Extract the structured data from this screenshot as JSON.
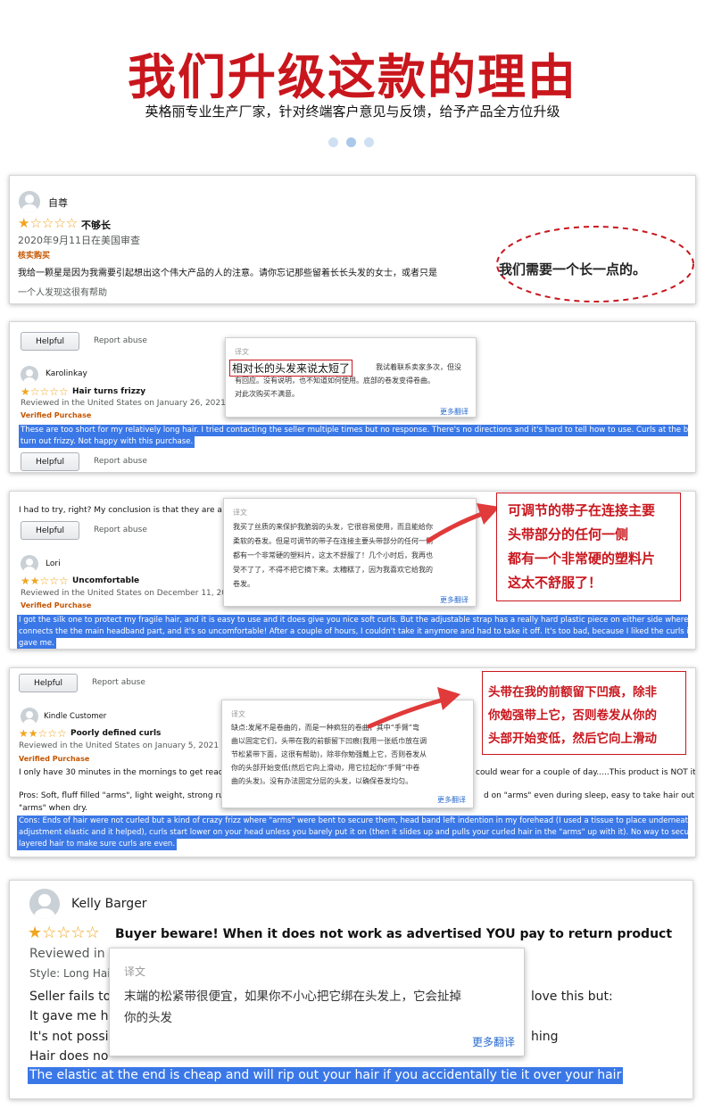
{
  "hero": {
    "title": "我们升级这款的理由",
    "subtitle": "英格丽专业生产厂家，针对终端客户意见与反馈，给予产品全方位升级"
  },
  "review1": {
    "author": "自尊",
    "stars": "★☆☆☆☆",
    "headline": "不够长",
    "date": "2020年9月11日在美国审查",
    "verified": "核实购买",
    "body": "我给一颗星是因为我需要引起想出这个伟大产品的人的注意。请你忘记那些留着长长头发的女士，或者只是",
    "callout": "我们需要一个长一点的。",
    "helpful": "一个人发现这很有帮助"
  },
  "review2": {
    "helpful_btn": "Helpful",
    "report": "Report abuse",
    "author": "Karolinkay",
    "stars": "★☆☆☆☆",
    "headline": "Hair turns frizzy",
    "date": "Reviewed in the United States on January 26, 2021",
    "verified": "Verified Purchase",
    "body1": "These are too short for my relatively long hair. I tried contacting the seller multiple times but no response. There's no directions and it's hard to tell how to use. Curls at the bottom",
    "body2": "turn out frizzy. Not happy with this purchase.",
    "helpful_btn2": "Helpful",
    "report2": "Report abuse",
    "popup": {
      "label": "译文",
      "boxed": "相对长的头发来说太短了",
      "line1_tail": "我试着联系卖家多次，但没",
      "line2": "有回应。没有说明，也不知道如何使用。底部的卷发变得卷曲。",
      "line3": "对此次购买不满意。",
      "more": "更多翻译"
    }
  },
  "review3": {
    "top_text": "I had to try, right? My conclusion is that they are a was",
    "helpful_btn": "Helpful",
    "report": "Report abuse",
    "author": "Lori",
    "stars": "★★☆☆☆",
    "headline": "Uncomfortable",
    "date": "Reviewed in the United States on December 11, 2021",
    "verified": "Verified Purchase",
    "body1": "I got the silk one to protect my fragile hair, and it is easy to use and it does give you nice soft curls. But the adjustable strap has a really hard plastic piece on either side where it",
    "body2": "connects the the main headband part, and it's so uncomfortable! After a couple of hours, I couldn't take it anymore and had to take it off. It's too bad, because I liked the curls it",
    "body3": "gave me.",
    "popup": {
      "label": "译文",
      "lines": [
        "我买了丝质的来保护我脆弱的头发，它很容易使用，而且能给你",
        "柔软的卷发。但是可调节的带子在连接主要头带部分的任何一侧",
        "都有一个非常硬的塑料片，这太不舒服了！几个小时后，我再也",
        "受不了了，不得不把它摘下来。太糟糕了，因为我喜欢它给我的",
        "卷发。"
      ],
      "more": "更多翻译"
    },
    "callout": [
      "可调节的带子在连接主要",
      "头带部分的任何一侧",
      "都有一个非常硬的塑料片",
      "这太不舒服了！"
    ]
  },
  "review4": {
    "helpful_btn": "Helpful",
    "report": "Report abuse",
    "author": "Kindle Customer",
    "stars": "★★☆☆☆",
    "headline": "Poorly defined curls",
    "date": "Reviewed in the United States on January 5, 2021",
    "verified": "Verified Purchase",
    "body1_head": "I only have 30 minutes in the mornings to get ready ar",
    "body1_tail": "could wear for a couple of day.....This product is NOT it.",
    "pros_head": "Pros: Soft, fluff filled \"arms\", light weight, strong rubbe",
    "pros_tail": "d on \"arms\" even during sleep, easy to take hair out of",
    "pros2": "\"arms\" when dry.",
    "cons1": "Cons: Ends of hair were not curled but a kind of crazy frizz where \"arms\" were bent to secure them, head band left indention in my forehead (I used a tissue to place underneath",
    "cons2": "adjustment elastic and it helped), curls start lower on your head unless you barely put it on (then it slides up and pulls your curled hair in the \"arms\" up with it). No way to secure",
    "cons3": "layered hair to make sure curls are even.",
    "popup": {
      "label": "译文",
      "lines": [
        "缺点:发尾不是卷曲的，而是一种疯狂的卷曲，其中“手臂”弯",
        "曲以固定它们，头带在我的前额留下凹痕(我用一张纸巾放在调",
        "节松紧带下面，这很有帮助)，除非你勉强戴上它，否则卷发从",
        "你的头部开始变低(然后它向上滑动，用它拉起你“手臂”中卷",
        "曲的头发)。没有办法固定分层的头发，以确保卷发均匀。"
      ],
      "more": "更多翻译"
    },
    "callout": [
      "头带在我的前额留下凹痕，除非",
      "你勉强带上它，否则卷发从你的",
      "头部开始变低，然后它向上滑动"
    ]
  },
  "review5": {
    "author": "Kelly Barger",
    "stars": "★☆☆☆☆",
    "headline": "Buyer beware! When it does not work as advertised YOU pay to return product",
    "date_head": "Reviewed in",
    "style_head": "Style: Long Hai",
    "line1_head": "Seller fails to",
    "line1_tail": "love this but:",
    "line2_head": "It gave me he",
    "line3_head": "It's not possil",
    "line3_tail": "hing",
    "line4_head": "Hair does no",
    "highlight": "The elastic at the end is cheap and will rip out your hair if you accidentally tie it over your hair",
    "popup": {
      "label": "译文",
      "line1": "末端的松紧带很便宜，如果你不小心把它绑在头发上，它会扯掉",
      "line2": "你的头发",
      "more": "更多翻译"
    }
  },
  "colors": {
    "brand_red": "#c9161d",
    "highlight_blue": "#3b78e7",
    "star_orange": "#f0a51d",
    "link_blue": "#2a6bd0"
  }
}
